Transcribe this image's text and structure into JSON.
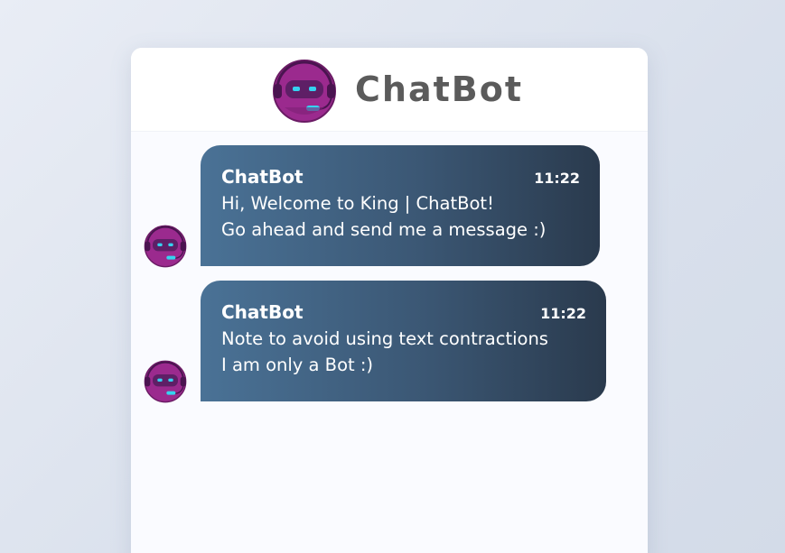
{
  "header": {
    "title": "ChatBot",
    "avatar_icon": "robot-avatar-icon"
  },
  "messages": [
    {
      "sender": "ChatBot",
      "time": "11:22",
      "lines": [
        "Hi, Welcome to King | ChatBot!",
        "Go ahead and send me a message :)"
      ]
    },
    {
      "sender": "ChatBot",
      "time": "11:22",
      "lines": [
        "Note to avoid using text contractions",
        "I am only a Bot :)"
      ]
    }
  ],
  "colors": {
    "bubble_start": "#4a7296",
    "bubble_end": "#2a3a4d",
    "robot_purple": "#9b2a8e",
    "robot_visor": "#5e1f66",
    "robot_eyes": "#35d3f0",
    "title_gray": "#5b5b5b"
  }
}
